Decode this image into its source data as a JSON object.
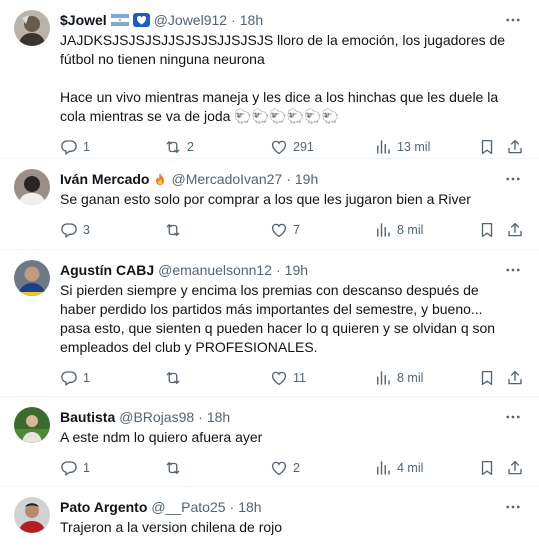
{
  "tweets": [
    {
      "name": "$Jowel",
      "handle": "@Jowel912",
      "dot": "·",
      "time": "18h",
      "text": "JAJDKSJSJSJSJJSJSJSJJSJSJS lloro de la emoción, los jugadores de fútbol no tienen ninguna neurona\n\nHace un vivo mientras maneja y les dice a los hinchas que les duele la cola mientras se va de joda 🐑🐑🐑🐑🐑🐑",
      "replies": "1",
      "retweets": "2",
      "likes": "291",
      "views": "13 mil",
      "badges": [
        "argentina-flag-icon",
        "blue-heart-icon"
      ]
    },
    {
      "name": "Iván Mercado",
      "handle": "@MercadoIvan27",
      "dot": "·",
      "time": "19h",
      "text": "Se ganan esto solo por comprar a los que les jugaron bien a River",
      "replies": "3",
      "retweets": "",
      "likes": "7",
      "views": "8 mil",
      "badges": [
        "flame-emoji-icon"
      ]
    },
    {
      "name": "Agustín CABJ",
      "handle": "@emanuelsonn12",
      "dot": "·",
      "time": "19h",
      "text": "Si pierden siempre y encima los premias con descanso después de haber perdido los partidos más importantes del semestre, y bueno... pasa esto, que sienten q pueden hacer lo q quieren y se olvidan q son empleados del club y PROFESIONALES.",
      "replies": "1",
      "retweets": "",
      "likes": "11",
      "views": "8 mil",
      "badges": []
    },
    {
      "name": "Bautista",
      "handle": "@BRojas98",
      "dot": "·",
      "time": "18h",
      "text": "A este ndm lo quiero afuera ayer",
      "replies": "1",
      "retweets": "",
      "likes": "2",
      "views": "4 mil",
      "badges": []
    },
    {
      "name": "Pato Argento",
      "handle": "@__Pato25",
      "dot": "·",
      "time": "18h",
      "text": "Trajeron a la version chilena de rojo",
      "replies": "",
      "retweets": "",
      "likes": "",
      "views": "",
      "badges": []
    }
  ],
  "colors": {
    "text": "#0f1419",
    "muted": "#536471",
    "divider": "#eff3f4"
  }
}
